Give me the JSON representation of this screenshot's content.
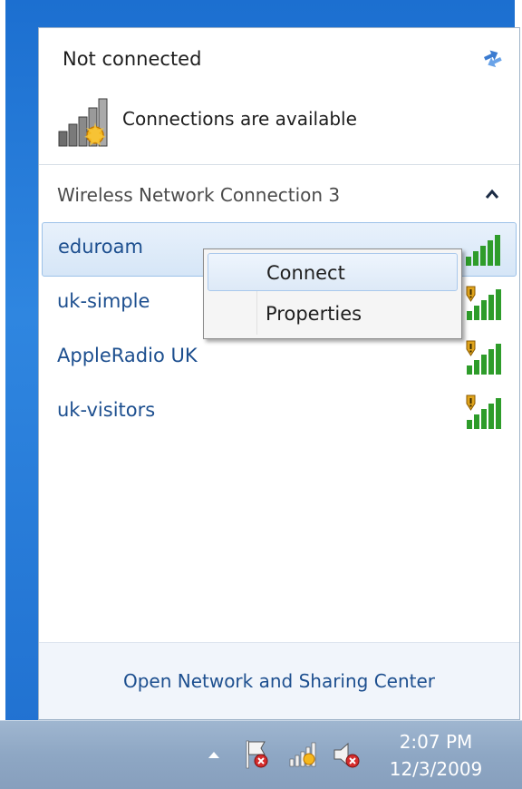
{
  "flyout": {
    "status_title": "Not connected",
    "availability_text": "Connections are available",
    "section_title": "Wireless Network Connection 3",
    "footer_link": "Open Network and Sharing Center"
  },
  "networks": [
    {
      "name": "eduroam",
      "secured": false,
      "signal_bars": 5,
      "selected": true
    },
    {
      "name": "uk-simple",
      "secured": true,
      "signal_bars": 5,
      "selected": false
    },
    {
      "name": "AppleRadio UK",
      "secured": true,
      "signal_bars": 5,
      "selected": false
    },
    {
      "name": "uk-visitors",
      "secured": true,
      "signal_bars": 5,
      "selected": false
    }
  ],
  "context_menu": {
    "items": [
      {
        "label": "Connect"
      },
      {
        "label": "Properties"
      }
    ]
  },
  "taskbar": {
    "time": "2:07 PM",
    "date": "12/3/2009"
  },
  "icons": {
    "refresh": "refresh-icon",
    "availability": "network-available-icon",
    "collapse": "chevron-up-icon",
    "signal": "wireless-signal-icon",
    "shield": "security-shield-icon",
    "tray_arrow": "show-hidden-icons-icon",
    "action_center": "action-center-flag-icon",
    "network_tray": "network-tray-icon",
    "volume": "volume-muted-icon"
  },
  "colors": {
    "link_blue": "#1d4f8f",
    "signal_green": "#2e9c2a",
    "desktop_blue": "#1f73d3"
  }
}
